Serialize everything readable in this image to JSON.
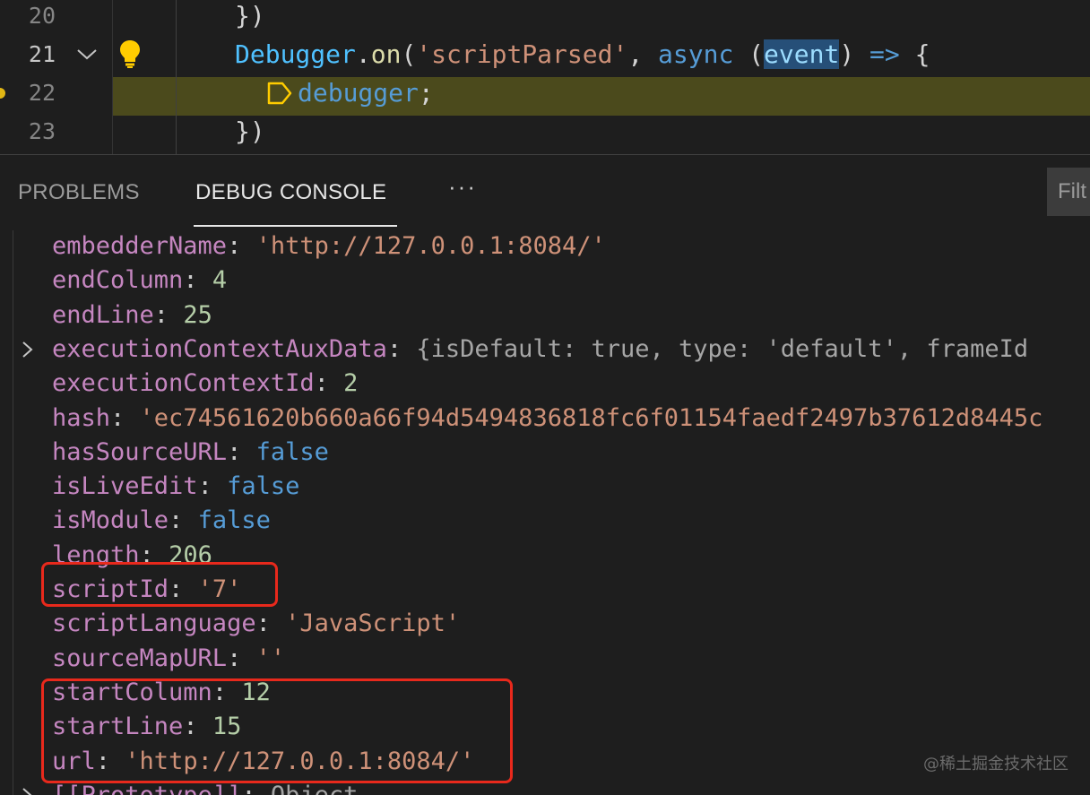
{
  "editor": {
    "lines": [
      {
        "number": "20",
        "text": "})"
      },
      {
        "number": "21",
        "tokens": {
          "obj": "Debugger",
          "dot": ".",
          "fn": "on",
          "open": "(",
          "str": "'scriptParsed'",
          "comma": ", ",
          "kw": "async",
          "paren_open": " (",
          "param": "event",
          "paren_close": ")",
          "arrow": " =>",
          "brace": " {"
        }
      },
      {
        "number": "22",
        "kw": "debugger",
        "semi": ";"
      },
      {
        "number": "23",
        "text": "})"
      }
    ]
  },
  "panel": {
    "tabs": [
      "PROBLEMS",
      "DEBUG CONSOLE"
    ],
    "more": "···",
    "filter_placeholder": "Filt"
  },
  "console": {
    "properties": [
      {
        "key": "embedderName",
        "value": "'http://127.0.0.1:8084/'",
        "kind": "string"
      },
      {
        "key": "endColumn",
        "value": "4",
        "kind": "number"
      },
      {
        "key": "endLine",
        "value": "25",
        "kind": "number"
      },
      {
        "key": "executionContextAuxData",
        "value": "{isDefault: true, type: 'default', frameId",
        "kind": "object",
        "expandable": true
      },
      {
        "key": "executionContextId",
        "value": "2",
        "kind": "number"
      },
      {
        "key": "hash",
        "value": "'ec74561620b660a66f94d5494836818fc6f01154faedf2497b37612d8445c",
        "kind": "string"
      },
      {
        "key": "hasSourceURL",
        "value": "false",
        "kind": "boolean"
      },
      {
        "key": "isLiveEdit",
        "value": "false",
        "kind": "boolean"
      },
      {
        "key": "isModule",
        "value": "false",
        "kind": "boolean"
      },
      {
        "key": "length",
        "value": "206",
        "kind": "number"
      },
      {
        "key": "scriptId",
        "value": "'7'",
        "kind": "string"
      },
      {
        "key": "scriptLanguage",
        "value": "'JavaScript'",
        "kind": "string"
      },
      {
        "key": "sourceMapURL",
        "value": "''",
        "kind": "string"
      },
      {
        "key": "startColumn",
        "value": "12",
        "kind": "number"
      },
      {
        "key": "startLine",
        "value": "15",
        "kind": "number"
      },
      {
        "key": "url",
        "value": "'http://127.0.0.1:8084/'",
        "kind": "string"
      },
      {
        "key": "[[Prototype]]",
        "value": "Object",
        "kind": "object",
        "expandable": true
      }
    ]
  },
  "watermark": "@稀土掘金技术社区",
  "colors": {
    "background": "#1e1e1e",
    "highlight_line": "#4b4a1c",
    "annotation_red": "#e8291c",
    "property_key": "#c586c0",
    "string_value": "#ce9178",
    "number_value": "#b5cea8",
    "boolean_value": "#569cd6"
  },
  "icons": [
    "chevron-down-icon",
    "lightbulb-icon",
    "breakpoint-icon",
    "debug-stop-arrow-icon",
    "chevron-right-icon"
  ]
}
